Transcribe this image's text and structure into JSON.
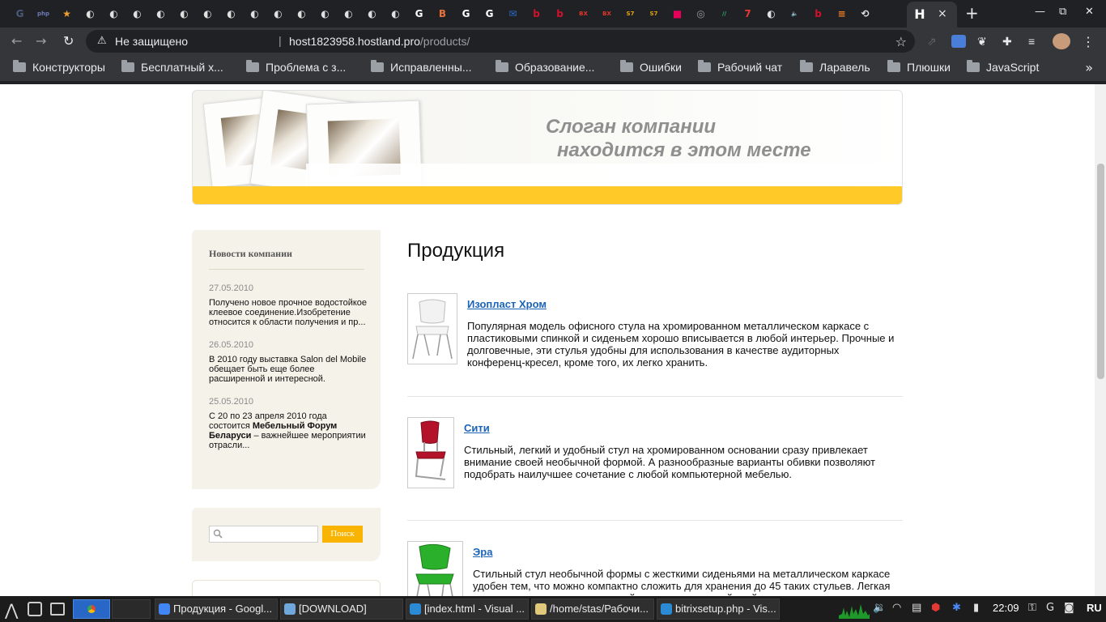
{
  "browser": {
    "active_tab_icon": "hostland-h",
    "new_tab_label": "+",
    "close_tab_label": "×",
    "address": {
      "security_label": "Не защищено",
      "separator": "|",
      "host": "host1823958.hostland.pro",
      "path": "/products/"
    },
    "tabs": [
      {
        "icon": "G",
        "color": "#4a5a7a"
      },
      {
        "icon": "php",
        "color": "#6c7ab8"
      },
      {
        "icon": "★",
        "color": "#f0a030"
      },
      {
        "icon": "◐",
        "color": "#e0e0e0"
      },
      {
        "icon": "◐",
        "color": "#e0e0e0"
      },
      {
        "icon": "◐",
        "color": "#e0e0e0"
      },
      {
        "icon": "◐",
        "color": "#e0e0e0"
      },
      {
        "icon": "◐",
        "color": "#e0e0e0"
      },
      {
        "icon": "◐",
        "color": "#e0e0e0"
      },
      {
        "icon": "◐",
        "color": "#e0e0e0"
      },
      {
        "icon": "◐",
        "color": "#e0e0e0"
      },
      {
        "icon": "◐",
        "color": "#e0e0e0"
      },
      {
        "icon": "◐",
        "color": "#e0e0e0"
      },
      {
        "icon": "◐",
        "color": "#e0e0e0"
      },
      {
        "icon": "◐",
        "color": "#e0e0e0"
      },
      {
        "icon": "◐",
        "color": "#e0e0e0"
      },
      {
        "icon": "◐",
        "color": "#e0e0e0"
      },
      {
        "icon": "G",
        "color": "#ffffff"
      },
      {
        "icon": "B",
        "color": "#e8703a"
      },
      {
        "icon": "G",
        "color": "#ffffff"
      },
      {
        "icon": "G",
        "color": "#ffffff"
      },
      {
        "icon": "✉",
        "color": "#2a6acb"
      },
      {
        "icon": "b",
        "color": "#d0122d"
      },
      {
        "icon": "b",
        "color": "#d0122d"
      },
      {
        "icon": "BX",
        "color": "#e0352b"
      },
      {
        "icon": "BX",
        "color": "#e0352b"
      },
      {
        "icon": "S7",
        "color": "#e6a210"
      },
      {
        "icon": "S7",
        "color": "#e6a210"
      },
      {
        "icon": "■",
        "color": "#e6005a"
      },
      {
        "icon": "◎",
        "color": "#9a9a9a"
      },
      {
        "icon": "//",
        "color": "#2bb673"
      },
      {
        "icon": "7",
        "color": "#e53935"
      },
      {
        "icon": "◐",
        "color": "#e0e0e0"
      },
      {
        "icon": "🔈",
        "color": "#8a8a8a"
      },
      {
        "icon": "b",
        "color": "#d0122d"
      },
      {
        "icon": "≡",
        "color": "#f48024"
      },
      {
        "icon": "⟲",
        "color": "#e0e0e0"
      }
    ],
    "bookmarks": [
      "Конструкторы",
      "Бесплатный х...",
      "Проблема с з...",
      "Исправленны...",
      "Образование...",
      "Ошибки",
      "Рабочий чат",
      "Ларавель",
      "Плюшки",
      "JavaScript"
    ],
    "bookmarks_more": "»"
  },
  "page": {
    "slogan_line1": "Слоган компании",
    "slogan_line2": "находится в этом месте",
    "news": {
      "title": "Новости компании",
      "items": [
        {
          "date": "27.05.2010",
          "text": "Получено новое прочное водостойкое клеевое соединение.Изобретение относится к области получения и пр...",
          "bold": "",
          "tail": ""
        },
        {
          "date": "26.05.2010",
          "text": "В 2010 году выставка Salon del Mobile обещает быть еще более расширенной и интересной.",
          "bold": "",
          "tail": ""
        },
        {
          "date": "25.05.2010",
          "text": "С 20 по 23 апреля 2010 года состоится ",
          "bold": "Мебельный Форум Беларуси",
          "tail": " – важнейшее мероприятии отрасли..."
        }
      ]
    },
    "search": {
      "placeholder": "",
      "button_label": "Поиск"
    },
    "heading": "Продукция",
    "products": [
      {
        "name": "Изопласт Хром",
        "description": "Популярная модель офисного стула на хромированном металлическом каркасе с пластиковыми спинкой и сиденьем хорошо вписывается в любой интерьер. Прочные и долговечные, эти стулья удобны для использования в качестве аудиторных конференц-кресел, кроме того, их легко хранить.",
        "color": "#f2f2f2"
      },
      {
        "name": "Сити",
        "description": "Стильный, легкий и удобный стул на хромированном основании сразу привлекает внимание своей необычной формой. А разнообразные варианты обивки позволяют подобрать наилучшее сочетание с любой компьютерной мебелью.",
        "color": "#b3122a"
      },
      {
        "name": "Эра",
        "description": "Стильный стул необычной формы с жесткими сиденьями на металлическом каркасе удобен тем, что можно компактно сложить для хранения до 45 таких стульев. Легкая и прочная модель отлично подойдет к компьютерной стойке, также ее можно",
        "color": "#2bb02b"
      }
    ]
  },
  "taskbar": {
    "windows": [
      {
        "title": "Продукция - Googl...",
        "color": "#4285f4"
      },
      {
        "title": "[DOWNLOAD]",
        "color": "#6fa8dc"
      },
      {
        "title": "[index.html - Visual ...",
        "color": "#2a8ad4"
      },
      {
        "title": "/home/stas/Рабочи...",
        "color": "#e0c97a"
      },
      {
        "title": "bitrixsetup.php - Vis...",
        "color": "#2a8ad4"
      }
    ],
    "clock": "22:09",
    "language": "RU"
  }
}
